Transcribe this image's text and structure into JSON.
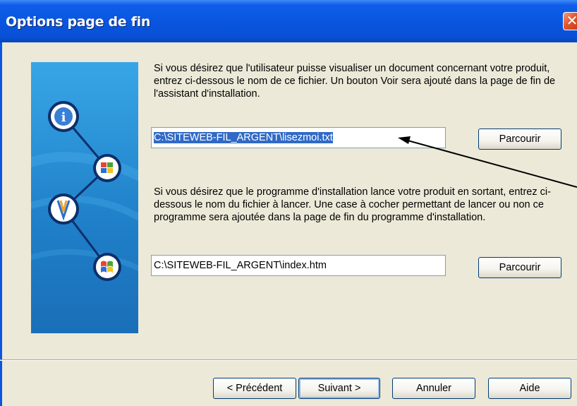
{
  "window": {
    "title": "Options page de fin",
    "close_glyph": "✕"
  },
  "side_panel": {
    "icons": [
      "info-icon",
      "windows-flag-icon",
      "installer-brush-icon",
      "windows-xp-flag-icon"
    ]
  },
  "readme_section": {
    "description": "Si vous désirez que l'utilisateur puisse visualiser un document concernant votre produit, entrez ci-dessous le nom de ce fichier. Un bouton Voir sera ajouté dans la page de fin de l'assistant d'installation.",
    "file_value": "C:\\SITEWEB-FIL_ARGENT\\lisezmoi.txt",
    "browse_label": "Parcourir"
  },
  "launch_section": {
    "description": "Si vous désirez que le programme d'installation lance votre produit en sortant, entrez ci-dessous le nom du fichier à lancer. Une case à cocher permettant de lancer ou non ce programme sera ajoutée dans la page de fin du programme d'installation.",
    "file_value": "C:\\SITEWEB-FIL_ARGENT\\index.htm",
    "browse_label": "Parcourir"
  },
  "footer": {
    "previous_label": "< Précédent",
    "next_label": "Suivant >",
    "cancel_label": "Annuler",
    "help_label": "Aide"
  },
  "colors": {
    "titlebar": "#0a56e0",
    "dialog_bg": "#ece9d8",
    "side_panel": "#1f7fc8",
    "selection": "#316ac5",
    "close_button": "#e0552d"
  }
}
